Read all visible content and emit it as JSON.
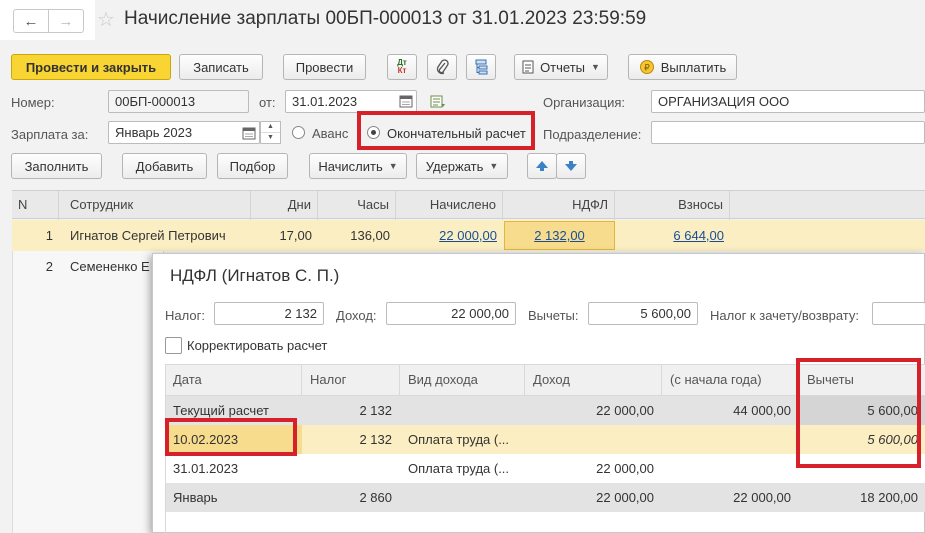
{
  "window": {
    "title": "Начисление зарплаты 00БП-000013 от 31.01.2023 23:59:59",
    "back_glyph": "←",
    "forward_glyph": "→",
    "star_glyph": "☆"
  },
  "toolbar": {
    "post_close": "Провести и закрыть",
    "save": "Записать",
    "post": "Провести",
    "dt_kt_top": "Дт",
    "dt_kt_bottom": "Кт",
    "reports": "Отчеты",
    "pay": "Выплатить"
  },
  "header": {
    "number_label": "Номер:",
    "number_value": "00БП-000013",
    "date_label": "от:",
    "date_value": "31.01.2023",
    "org_label": "Организация:",
    "org_value": "ОРГАНИЗАЦИЯ ООО",
    "salary_label": "Зарплата за:",
    "salary_value": "Январь 2023",
    "advance_label": "Аванс",
    "final_label": "Окончательный расчет",
    "division_label": "Подразделение:",
    "division_value": ""
  },
  "actions": {
    "fill": "Заполнить",
    "add": "Добавить",
    "pick": "Подбор",
    "accrue": "Начислить",
    "withhold": "Удержать"
  },
  "grid": {
    "columns": [
      "N",
      "Сотрудник",
      "Дни",
      "Часы",
      "Начислено",
      "НДФЛ",
      "Взносы"
    ],
    "rows": [
      {
        "n": "1",
        "employee": "Игнатов Сергей Петрович",
        "days": "17,00",
        "hours": "136,00",
        "accrued": "22 000,00",
        "ndfl": "2 132,00",
        "contrib": "6 644,00"
      },
      {
        "n": "2",
        "employee": "Семененко Е"
      }
    ]
  },
  "popup": {
    "title": "НДФЛ (Игнатов С. П.)",
    "tax_label": "Налог:",
    "tax_value": "2 132",
    "income_label": "Доход:",
    "income_value": "22 000,00",
    "deductions_label": "Вычеты:",
    "deductions_value": "5 600,00",
    "offset_label": "Налог к зачету/возврату:",
    "offset_value": "",
    "correct_label": "Корректировать расчет",
    "columns": [
      "Дата",
      "Налог",
      "Вид дохода",
      "Доход",
      "(с начала года)",
      "Вычеты"
    ],
    "rows": [
      {
        "date": "Текущий расчет",
        "tax": "2 132",
        "kind": "",
        "income": "22 000,00",
        "ytd": "44 000,00",
        "deduct": "5 600,00"
      },
      {
        "date": "10.02.2023",
        "tax": "2 132",
        "kind": "Оплата труда (...",
        "income": "",
        "ytd": "",
        "deduct": "5 600,00"
      },
      {
        "date": "31.01.2023",
        "tax": "",
        "kind": "Оплата труда (...",
        "income": "22 000,00",
        "ytd": "",
        "deduct": ""
      },
      {
        "date": "Январь",
        "tax": "2 860",
        "kind": "",
        "income": "22 000,00",
        "ytd": "22 000,00",
        "deduct": "18 200,00"
      }
    ]
  },
  "colors": {
    "primary_button": "#f8d532",
    "selected_row": "#fbeec3",
    "highlight_box": "#d6212b",
    "link": "#1a4f93"
  }
}
